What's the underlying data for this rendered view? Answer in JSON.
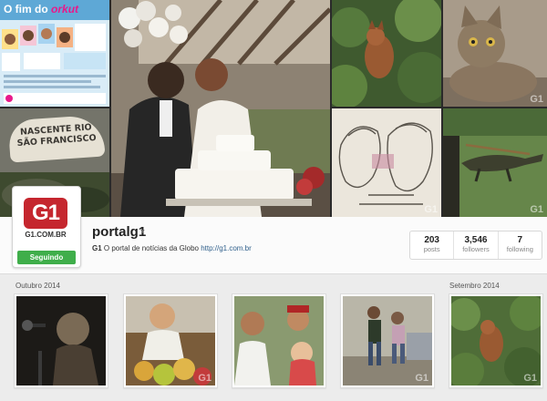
{
  "cover": {
    "orkut_title_prefix": "O fim do",
    "orkut_title_brand": "orkut",
    "stone_sign_text": "NASCENTE RIO SÃO FRANCISCO",
    "watermark": "G1"
  },
  "profile": {
    "avatar_logo_text": "G1",
    "avatar_logo_url_text": "G1.COM.BR",
    "follow_button": "Seguindo",
    "username": "portalg1",
    "bio_name": "G1",
    "bio_text": "O portal de notícias da Globo",
    "bio_link": "http://g1.com.br",
    "stats": [
      {
        "value": "203",
        "label": "posts"
      },
      {
        "value": "3,546",
        "label": "followers"
      },
      {
        "value": "7",
        "label": "following"
      }
    ]
  },
  "feed": {
    "months": [
      {
        "label": "Outubro 2014"
      },
      {
        "label": "Setembro 2014"
      }
    ],
    "posts": [
      {
        "icon": "photo-musician"
      },
      {
        "icon": "photo-fruit-vendor"
      },
      {
        "icon": "photo-child-with-family"
      },
      {
        "icon": "photo-street-walkers"
      },
      {
        "icon": "photo-fox-in-bush"
      }
    ]
  },
  "colors": {
    "follow_green": "#3fae4a",
    "g1_red": "#c5262e",
    "link_blue": "#2e5e8a"
  }
}
